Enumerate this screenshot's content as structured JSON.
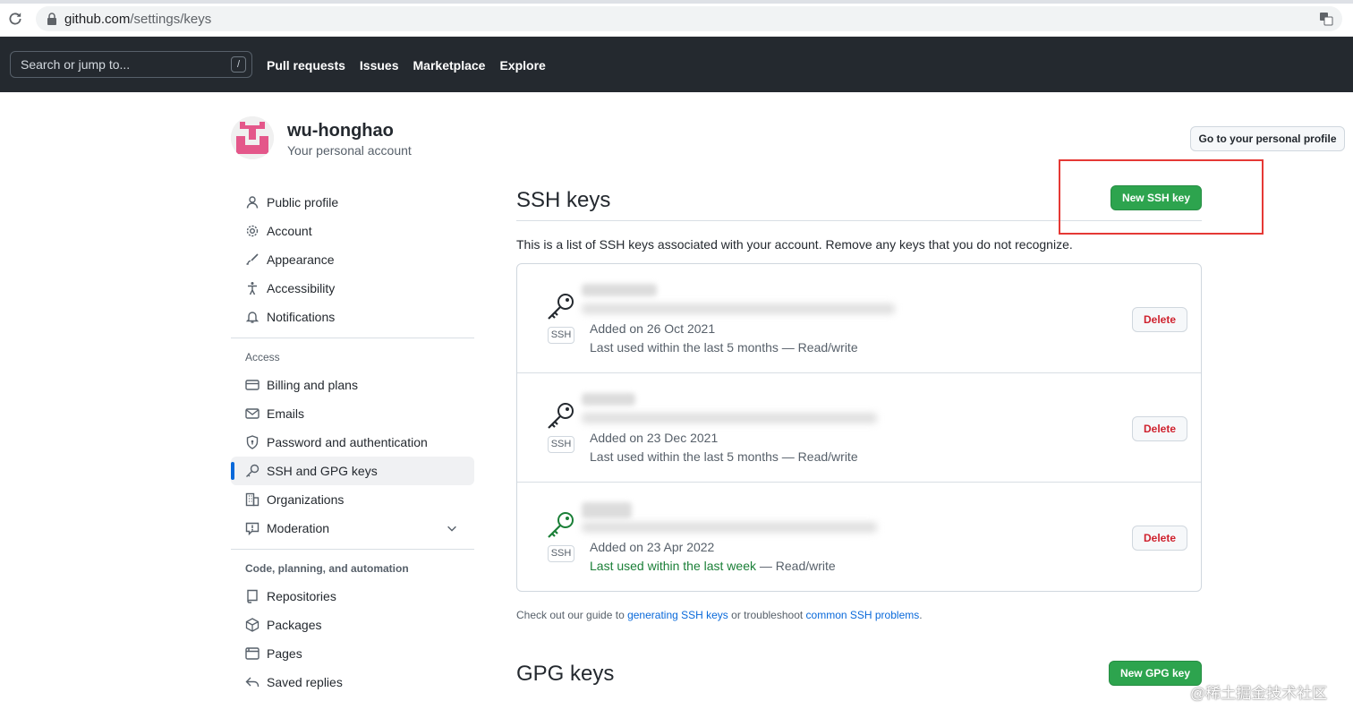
{
  "browser": {
    "url_host": "github.com",
    "url_path": "/settings/keys"
  },
  "header": {
    "search_placeholder": "Search or jump to...",
    "search_shortcut": "/",
    "nav": [
      "Pull requests",
      "Issues",
      "Marketplace",
      "Explore"
    ]
  },
  "account": {
    "name": "wu-honghao",
    "subtitle": "Your personal account",
    "profile_button": "Go to your personal profile"
  },
  "sidebar": {
    "top_items": [
      {
        "label": "Public profile",
        "icon": "person-icon"
      },
      {
        "label": "Account",
        "icon": "gear-icon"
      },
      {
        "label": "Appearance",
        "icon": "paintbrush-icon"
      },
      {
        "label": "Accessibility",
        "icon": "accessibility-icon"
      },
      {
        "label": "Notifications",
        "icon": "bell-icon"
      }
    ],
    "access_heading": "Access",
    "access_items": [
      {
        "label": "Billing and plans",
        "icon": "credit-card-icon"
      },
      {
        "label": "Emails",
        "icon": "mail-icon"
      },
      {
        "label": "Password and authentication",
        "icon": "shield-lock-icon"
      },
      {
        "label": "SSH and GPG keys",
        "icon": "key-icon",
        "active": true
      },
      {
        "label": "Organizations",
        "icon": "organization-icon"
      },
      {
        "label": "Moderation",
        "icon": "report-icon",
        "expandable": true
      }
    ],
    "code_heading": "Code, planning, and automation",
    "code_items": [
      {
        "label": "Repositories",
        "icon": "repo-icon"
      },
      {
        "label": "Packages",
        "icon": "package-icon"
      },
      {
        "label": "Pages",
        "icon": "browser-icon"
      },
      {
        "label": "Saved replies",
        "icon": "reply-icon"
      }
    ]
  },
  "ssh": {
    "title": "SSH keys",
    "new_button": "New SSH key",
    "intro": "This is a list of SSH keys associated with your account. Remove any keys that you do not recognize.",
    "keys": [
      {
        "badge": "SSH",
        "added": "Added on 26 Oct 2021",
        "used_prefix": "Last used within the last 5 months",
        "used_suffix": " — Read/write",
        "recent": false,
        "delete": "Delete"
      },
      {
        "badge": "SSH",
        "added": "Added on 23 Dec 2021",
        "used_prefix": "Last used within the last 5 months",
        "used_suffix": " — Read/write",
        "recent": false,
        "delete": "Delete"
      },
      {
        "badge": "SSH",
        "added": "Added on 23 Apr 2022",
        "used_prefix": "Last used within the last week",
        "used_suffix": " — Read/write",
        "recent": true,
        "delete": "Delete"
      }
    ],
    "guide_prefix": "Check out our guide to ",
    "guide_link1": "generating SSH keys",
    "guide_middle": " or troubleshoot ",
    "guide_link2": "common SSH problems",
    "guide_suffix": "."
  },
  "gpg": {
    "title": "GPG keys",
    "new_button": "New GPG key"
  },
  "colors": {
    "primary_green": "#2da44e",
    "danger_red": "#cf222e",
    "link_blue": "#0969da",
    "header_dark": "#24292f",
    "highlight_red": "#e53935"
  },
  "watermark": "@稀土掘金技术社区"
}
